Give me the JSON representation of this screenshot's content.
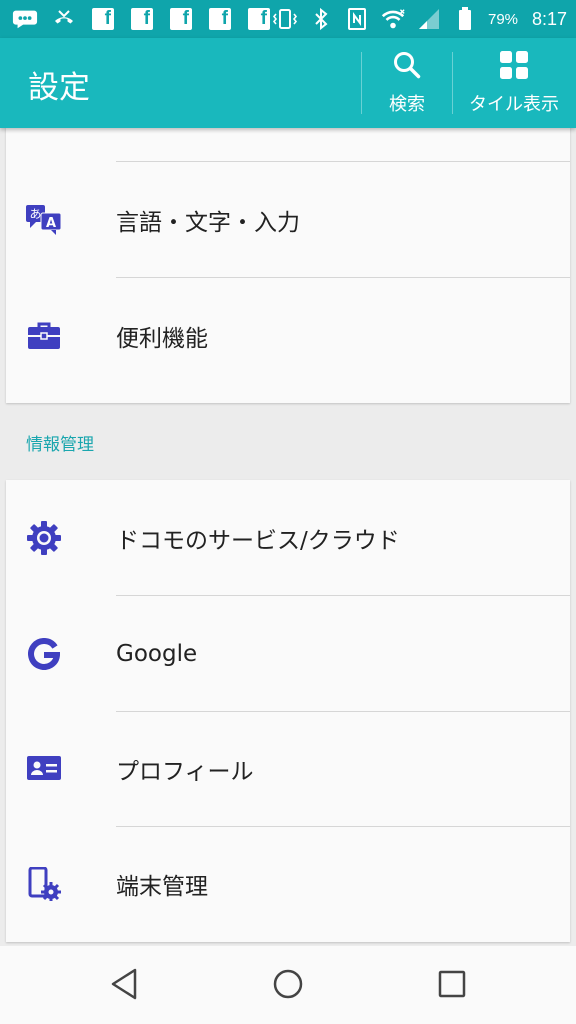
{
  "status_bar": {
    "battery_percent": "79%",
    "time": "8:17",
    "notification_icons": [
      "messenger-icon",
      "missed-call-icon",
      "facebook-icon",
      "facebook-icon",
      "facebook-icon",
      "facebook-icon",
      "facebook-icon"
    ],
    "system_icons": [
      "vibrate-icon",
      "bluetooth-icon",
      "nfc-icon",
      "wifi-icon",
      "signal-icon",
      "battery-icon"
    ]
  },
  "app_bar": {
    "title": "設定",
    "actions": [
      {
        "label": "検索",
        "icon": "search-icon"
      },
      {
        "label": "タイル表示",
        "icon": "tile-view-icon"
      }
    ]
  },
  "sections": [
    {
      "header": "",
      "items": [
        {
          "label": "言語・文字・入力",
          "icon": "language-icon"
        },
        {
          "label": "便利機能",
          "icon": "briefcase-icon"
        }
      ]
    },
    {
      "header": "情報管理",
      "items": [
        {
          "label": "ドコモのサービス/クラウド",
          "icon": "gear-icon"
        },
        {
          "label": "Google",
          "icon": "google-icon"
        },
        {
          "label": "プロフィール",
          "icon": "profile-card-icon"
        },
        {
          "label": "端末管理",
          "icon": "device-settings-icon"
        }
      ]
    }
  ],
  "nav_bar": {
    "buttons": [
      "back-icon",
      "home-icon",
      "recents-icon"
    ]
  },
  "colors": {
    "status_bar": "#0fa5ab",
    "app_bar": "#19b8bd",
    "icon_accent": "#3f3fc0",
    "section_header": "#1aa6ae"
  }
}
